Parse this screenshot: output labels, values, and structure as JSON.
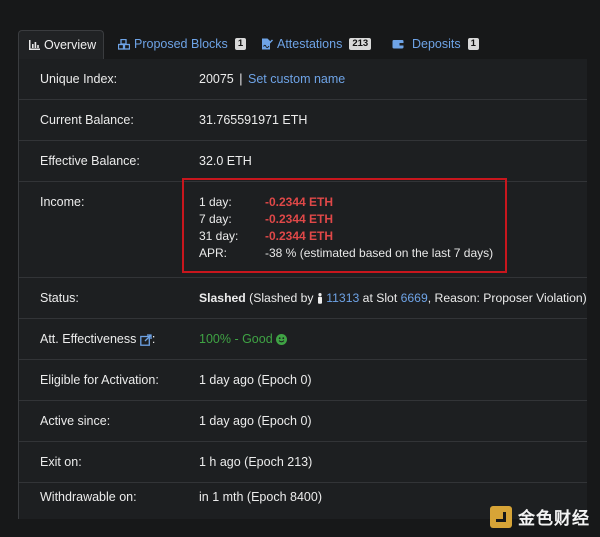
{
  "tabs": {
    "overview": {
      "label": "Overview",
      "icon": "chart-bar-icon"
    },
    "proposed_blocks": {
      "label": "Proposed Blocks",
      "count": "1",
      "icon": "cubes-icon"
    },
    "attestations": {
      "label": "Attestations",
      "count": "213",
      "icon": "file-signature-icon"
    },
    "deposits": {
      "label": "Deposits",
      "count": "1",
      "icon": "wallet-icon"
    }
  },
  "rows": {
    "unique_index": {
      "label": "Unique Index:",
      "value": "20075",
      "separator": "|",
      "link": "Set custom name"
    },
    "current_balance": {
      "label": "Current Balance:",
      "value": "31.765591971 ETH"
    },
    "effective_balance": {
      "label": "Effective Balance:",
      "value": "32.0 ETH"
    },
    "income": {
      "label": "Income:",
      "lines": [
        {
          "key": "1 day:",
          "value": "-0.2344 ETH"
        },
        {
          "key": "7 day:",
          "value": "-0.2344 ETH"
        },
        {
          "key": "31 day:",
          "value": "-0.2344 ETH"
        }
      ],
      "apr_key": "APR:",
      "apr_value": "-38 %",
      "apr_note": "(estimated based on the last 7 days)"
    },
    "status": {
      "label": "Status:",
      "state": "Slashed",
      "prefix": "(Slashed by",
      "validator": "11313",
      "at_slot": "at Slot",
      "slot": "6669",
      "reason": ", Reason: Proposer Violation)"
    },
    "att_effectiveness": {
      "label": "Att. Effectiveness",
      "colon": ":",
      "value": "100% - Good"
    },
    "eligible": {
      "label": "Eligible for Activation:",
      "value": "1 day ago (Epoch 0)"
    },
    "active_since": {
      "label": "Active since:",
      "value": "1 day ago (Epoch 0)"
    },
    "exit_on": {
      "label": "Exit on:",
      "value": "1 h ago (Epoch 213)"
    },
    "withdrawable": {
      "label": "Withdrawable on:",
      "value": "in 1 mth (Epoch 8400)"
    }
  },
  "watermark": {
    "text": "金色财经"
  },
  "colors": {
    "background": "#171819",
    "link": "#6ea3e6",
    "negative": "#e04848",
    "positive": "#3fa344",
    "highlight_border": "#c8161d"
  }
}
